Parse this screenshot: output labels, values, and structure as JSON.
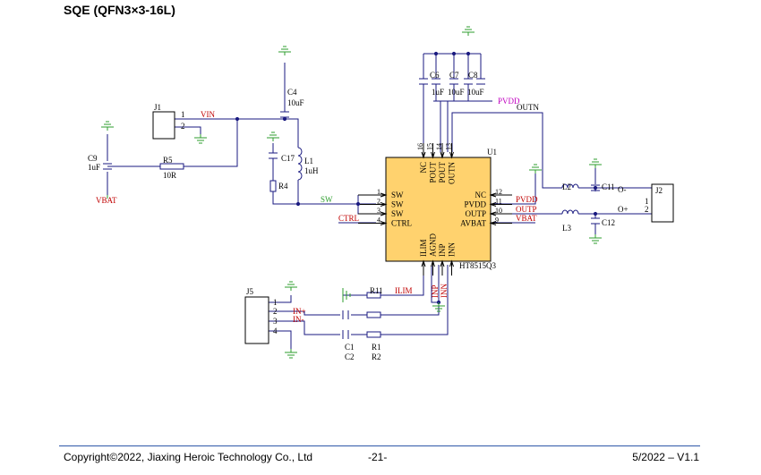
{
  "header": {
    "title": "SQE (QFN3×3-16L)"
  },
  "footer": {
    "copyright": "Copyright©2022, Jiaxing Heroic Technology Co., Ltd",
    "page": "-21-",
    "version": "5/2022 – V1.1"
  },
  "colors": {
    "wire": "#1a1a80",
    "ground": "#2e9e2e",
    "net_label": "#c00000",
    "power_net": "#c000c0",
    "chip_fill": "#ffd26e",
    "pin_line": "#000000"
  },
  "schematic": {
    "chip": {
      "ref": "U1",
      "part": "HT8515Q3",
      "left_pins": [
        {
          "num": "1",
          "name": "SW"
        },
        {
          "num": "2",
          "name": "SW"
        },
        {
          "num": "3",
          "name": "SW"
        },
        {
          "num": "4",
          "name": "CTRL"
        }
      ],
      "right_pins": [
        {
          "num": "12",
          "name": "NC"
        },
        {
          "num": "11",
          "name": "PVDD"
        },
        {
          "num": "10",
          "name": "OUTP"
        },
        {
          "num": "9",
          "name": "AVBAT"
        }
      ],
      "top_pins": [
        {
          "num": "16",
          "name": "NC"
        },
        {
          "num": "15",
          "name": "POUT"
        },
        {
          "num": "14",
          "name": "POUT"
        },
        {
          "num": "13",
          "name": "OUTN"
        }
      ],
      "bottom_pins": [
        {
          "num": "5",
          "name": "ILIM"
        },
        {
          "num": "6",
          "name": "AGND"
        },
        {
          "num": "7",
          "name": "INP"
        },
        {
          "num": "8",
          "name": "INN"
        }
      ]
    },
    "components": {
      "J1": {
        "ref": "J1",
        "pins": [
          "1",
          "2"
        ]
      },
      "J2": {
        "ref": "J2",
        "pins": [
          "1",
          "2"
        ]
      },
      "J5": {
        "ref": "J5",
        "pins": [
          "1",
          "2",
          "3",
          "4"
        ]
      },
      "C4": {
        "ref": "C4",
        "value": "10uF"
      },
      "C6": {
        "ref": "C6",
        "value": "1uF"
      },
      "C7": {
        "ref": "C7",
        "value": "10uF"
      },
      "C8": {
        "ref": "C8",
        "value": "10uF"
      },
      "C9": {
        "ref": "C9",
        "value": "1uF"
      },
      "C17": {
        "ref": "C17"
      },
      "R4": {
        "ref": "R4"
      },
      "L1": {
        "ref": "L1",
        "value": "1uH"
      },
      "R5": {
        "ref": "R5",
        "value": "10R"
      },
      "L2": {
        "ref": "L2"
      },
      "L3": {
        "ref": "L3"
      },
      "C11": {
        "ref": "C11"
      },
      "C12": {
        "ref": "C12"
      },
      "R11": {
        "ref": "R11"
      },
      "C1": {
        "ref": "C1"
      },
      "C2": {
        "ref": "C2"
      },
      "R1": {
        "ref": "R1"
      },
      "R2": {
        "ref": "R2"
      }
    },
    "nets": {
      "vin": "VIN",
      "vbat": "VBAT",
      "sw": "SW",
      "ctrl": "CTRL",
      "pvdd": "PVDD",
      "outn": "OUTN",
      "outp": "OUTP",
      "ilim": "ILIM",
      "inp": "INP",
      "inn": "INN",
      "in_plus": "IN+",
      "in_minus": "IN-",
      "o_minus": "O-",
      "o_plus": "O+"
    }
  }
}
